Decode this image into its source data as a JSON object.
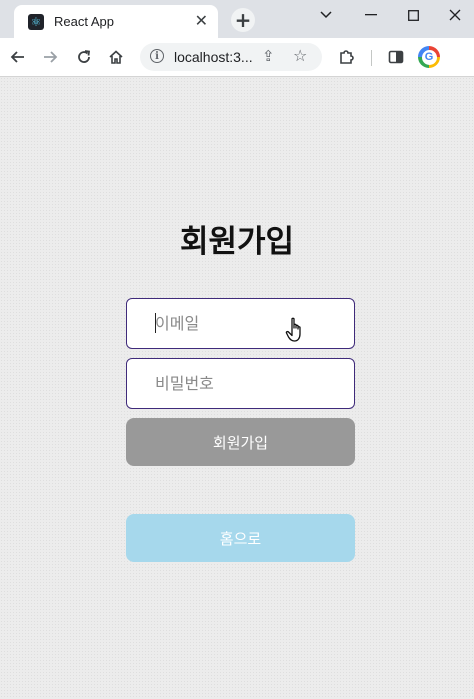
{
  "browser": {
    "tab_title": "React App",
    "tab_favicon": "react-icon",
    "url": "localhost:3...",
    "window_controls": [
      "chevron-down-icon",
      "minimize-icon",
      "maximize-icon",
      "close-icon"
    ]
  },
  "page": {
    "title": "회원가입",
    "email_placeholder": "이메일",
    "password_placeholder": "비밀번호",
    "signup_button": "회원가입",
    "home_button": "홈으로"
  },
  "colors": {
    "input_border": "#3f2a7a",
    "signup_button_bg": "#999999",
    "home_button_bg": "#a6d8ec",
    "page_bg": "#ececec"
  }
}
